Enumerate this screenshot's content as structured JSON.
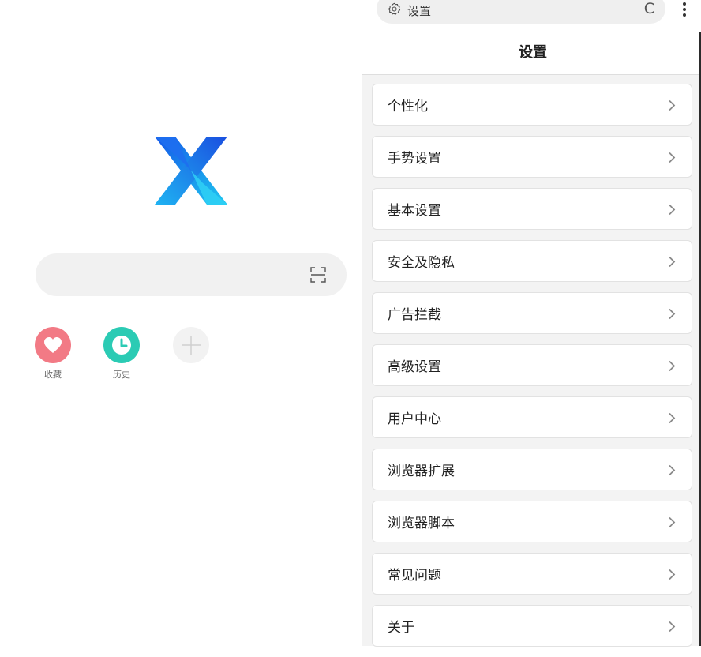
{
  "home": {
    "logo": "x-browser-logo",
    "search": {
      "placeholder": "",
      "scan_icon": "scan-icon"
    },
    "shortcuts": [
      {
        "label": "收藏",
        "icon": "heart-icon",
        "color": "#f27a85"
      },
      {
        "label": "历史",
        "icon": "clock-icon",
        "color": "#2bcbb4"
      },
      {
        "label": "",
        "icon": "plus-icon",
        "color": "#f2f2f2"
      }
    ]
  },
  "panel": {
    "address_bar": {
      "icon": "gear-icon",
      "text": "设置",
      "reload_icon": "reload-icon",
      "reload_glyph": "C"
    },
    "menu_icon": "more-vertical-icon",
    "title": "设置",
    "items": [
      {
        "label": "个性化"
      },
      {
        "label": "手势设置"
      },
      {
        "label": "基本设置"
      },
      {
        "label": "安全及隐私"
      },
      {
        "label": "广告拦截"
      },
      {
        "label": "高级设置"
      },
      {
        "label": "用户中心"
      },
      {
        "label": "浏览器扩展"
      },
      {
        "label": "浏览器脚本"
      },
      {
        "label": "常见问题"
      },
      {
        "label": "关于"
      }
    ]
  },
  "colors": {
    "accent_blue": "#1e6ff0",
    "accent_cyan": "#1ec8f0",
    "favorites": "#f27a85",
    "history": "#2bcbb4"
  }
}
